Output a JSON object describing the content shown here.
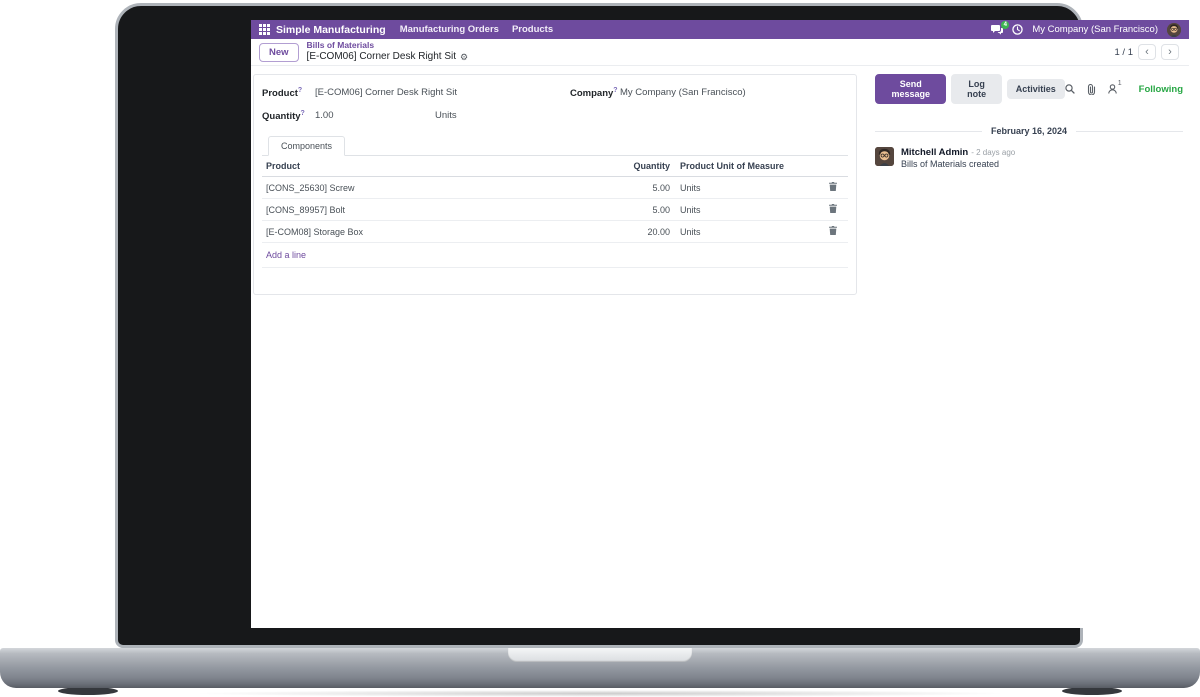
{
  "colors": {
    "accent_purple": "#6e4b9e",
    "following_green": "#28a745",
    "badge_green": "#3cb551",
    "laptop_body_gray": "#9298a0"
  },
  "icons": {
    "gear": "⚙",
    "chevron_left": "‹",
    "chevron_right": "›"
  },
  "navbar": {
    "app_name": "Simple Manufacturing",
    "menu_items": [
      "Manufacturing Orders",
      "Products"
    ],
    "message_badge": "4",
    "company": "My Company (San Francisco)"
  },
  "control_panel": {
    "new_button": "New",
    "breadcrumb_parent": "Bills of Materials",
    "breadcrumb_current": "[E-COM06] Corner Desk Right Sit",
    "pager_value": "1 / 1"
  },
  "form": {
    "help_marker": "?",
    "product_label": "Product",
    "product_value": "[E-COM06] Corner Desk Right Sit",
    "company_label": "Company",
    "company_value": "My Company (San Francisco)",
    "quantity_label": "Quantity",
    "quantity_value": "1.00",
    "quantity_uom": "Units",
    "tab_components": "Components",
    "table": {
      "col_product": "Product",
      "col_quantity": "Quantity",
      "col_uom": "Product Unit of Measure",
      "rows": [
        {
          "product": "[CONS_25630] Screw",
          "quantity": "5.00",
          "uom": "Units"
        },
        {
          "product": "[CONS_89957] Bolt",
          "quantity": "5.00",
          "uom": "Units"
        },
        {
          "product": "[E-COM08] Storage Box",
          "quantity": "20.00",
          "uom": "Units"
        }
      ],
      "add_line": "Add a line"
    }
  },
  "chatter": {
    "send_message": "Send message",
    "log_note": "Log note",
    "activities": "Activities",
    "followers_count": "1",
    "following": "Following",
    "date_divider": "February 16, 2024",
    "message": {
      "author": "Mitchell Admin",
      "time": "- 2 days ago",
      "body": "Bills of Materials created"
    }
  }
}
